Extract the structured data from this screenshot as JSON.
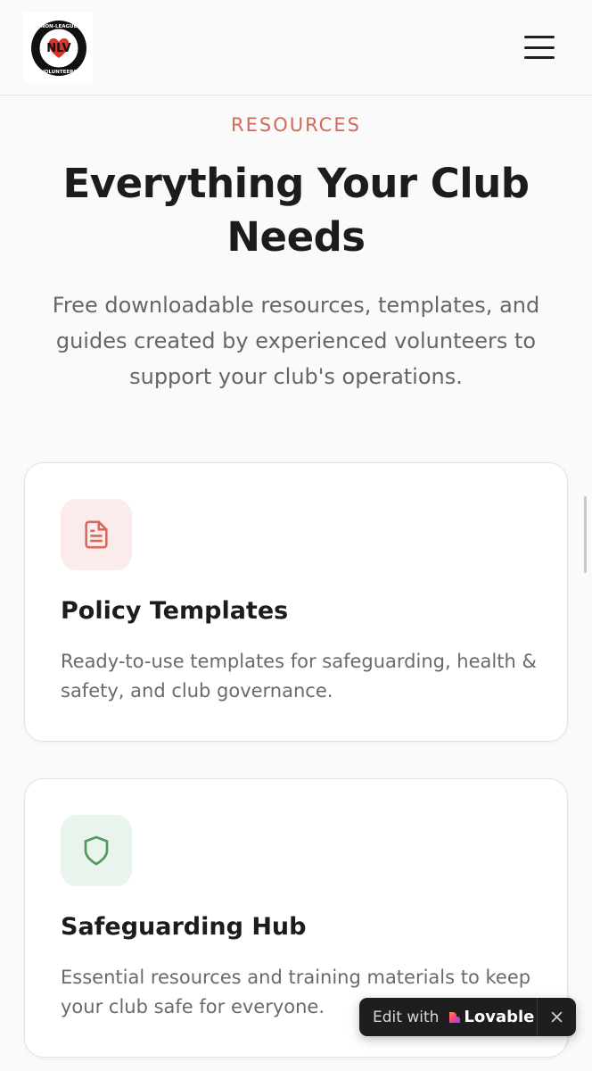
{
  "header": {
    "logo_icon": "nlv-logo",
    "logo_text_top": "NON-LEAGUE",
    "logo_initials": "NLV",
    "logo_text_bottom": "VOLUNTEERS",
    "menu_icon": "hamburger-menu-icon"
  },
  "hero": {
    "eyebrow": "RESOURCES",
    "title": "Everything Your Club Needs",
    "lead": "Free downloadable resources, templates, and guides created by experienced volunteers to support your club's operations."
  },
  "cards": [
    {
      "icon": "document-icon",
      "title": "Policy Templates",
      "description": "Ready-to-use templates for safeguarding, health & safety, and club governance."
    },
    {
      "icon": "shield-icon",
      "title": "Safeguarding Hub",
      "description": "Essential resources and training materials to keep your club safe for everyone."
    }
  ],
  "lovable_badge": {
    "edit_with": "Edit with",
    "brand": "Lovable",
    "close_icon": "close-icon"
  },
  "colors": {
    "accent": "#cf6b5c",
    "policy_icon": "#d9685c",
    "safeguarding_icon": "#4f9a62",
    "badge_bg": "#1e1e1e"
  }
}
